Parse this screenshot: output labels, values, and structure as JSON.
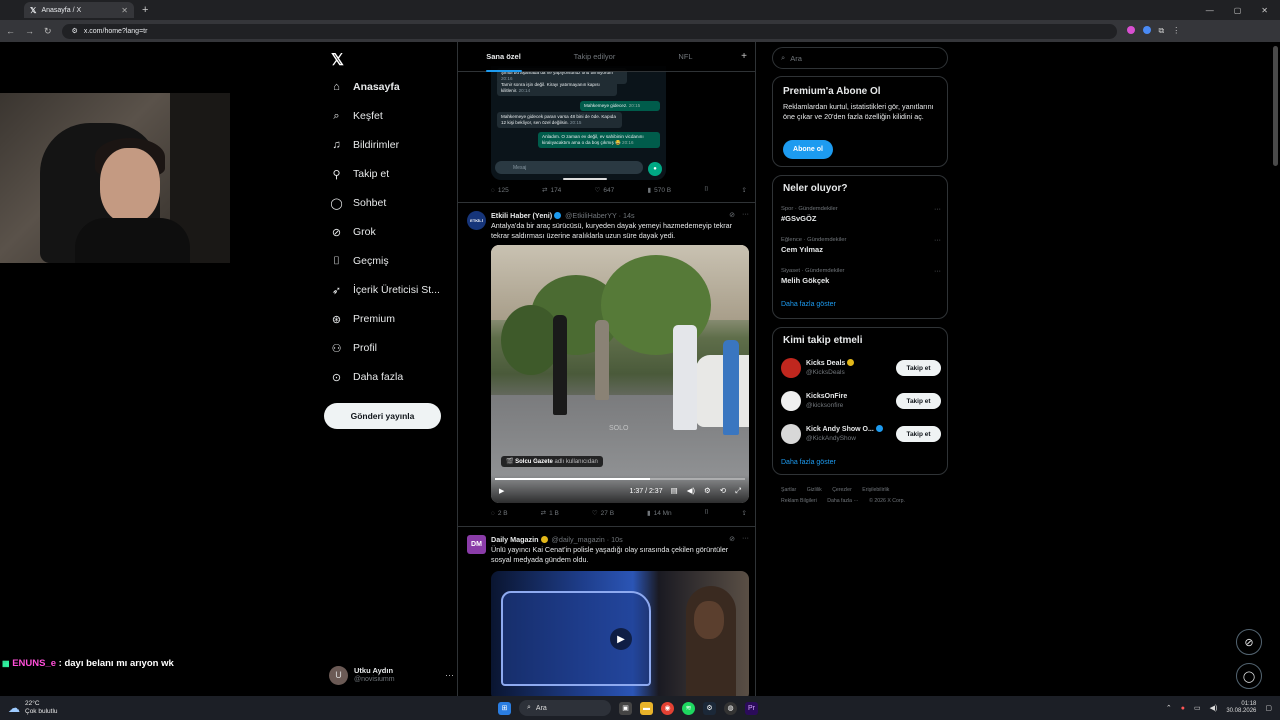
{
  "browser": {
    "tab_title": "Anasayfa / X",
    "url": "x.com/home?lang=tr"
  },
  "stream": {
    "chat_user": "ENUNS_e",
    "chat_message": ": dayı belanı mı arıyon wk"
  },
  "nav": {
    "items": [
      {
        "label": "Anasayfa",
        "icon": "home-icon"
      },
      {
        "label": "Keşfet",
        "icon": "search-icon"
      },
      {
        "label": "Bildirimler",
        "icon": "bell-icon"
      },
      {
        "label": "Takip et",
        "icon": "follow-icon"
      },
      {
        "label": "Sohbet",
        "icon": "chat-icon"
      },
      {
        "label": "Grok",
        "icon": "grok-icon"
      },
      {
        "label": "Geçmiş",
        "icon": "bookmark-icon"
      },
      {
        "label": "İçerik Üreticisi St...",
        "icon": "rocket-icon"
      },
      {
        "label": "Premium",
        "icon": "premium-icon"
      },
      {
        "label": "Profil",
        "icon": "person-icon"
      },
      {
        "label": "Daha fazla",
        "icon": "more-circle-icon"
      }
    ],
    "post_button": "Gönderi yayınla",
    "profile_name": "Utku Aydın",
    "profile_handle": "@novisiumm",
    "profile_initial": "U"
  },
  "feed": {
    "tabs": [
      "Sana özel",
      "Takip edilyor",
      "NFL"
    ],
    "whatsapp": {
      "messages": [
        {
          "text": "Şimdi bu aşamada da ne yapıyorsunuz onu bilmiyorum",
          "time": "20:16",
          "dir": "in"
        },
        {
          "text": "Tamir sonra işin değil. Kirayı yatırmayanın kapısı kilitlenir.",
          "time": "20:14",
          "dir": "in"
        },
        {
          "text": "Mahkemeye gidecez.",
          "time": "20:15",
          "dir": "out"
        },
        {
          "text": "Mahkemeye gidecek paran varsa 48 bini de öde. Kapıda 12 kişi bekliyor, sen özel değilsin.",
          "time": "20:15",
          "dir": "in"
        },
        {
          "text": "Anladım. O zaman ev değil, ev sahibinin vicdanını kiralıyacaktım ama o da boş çıkmış 😂",
          "time": "20:16",
          "dir": "out"
        }
      ],
      "input_placeholder": "Mesaj"
    },
    "post0_actions": {
      "replies": "125",
      "reposts": "174",
      "likes": "647",
      "views": "570 B"
    },
    "posts": [
      {
        "name": "Etkili Haber (Yeni)",
        "handle": "@EtkiliHaberYY",
        "time": "14s",
        "avatar_text": "ETKİLİ",
        "text": "Antalya'da bir araç sürücüsü, kuryeden dayak yemeyi hazmedemeyip tekrar tekrar saldırması üzerine aralıklarla uzun süre dayak yedi.",
        "credit_source": "Solcu Gazete",
        "credit_suffix": "adlı kullanıcıdan",
        "watermark": "SOLO",
        "video_time": "1:37 / 2:37",
        "video_progress": 0.62,
        "actions": {
          "replies": "2 B",
          "reposts": "1 B",
          "likes": "27 B",
          "views": "14 Mn"
        }
      },
      {
        "name": "Daily Magazin",
        "handle": "@daily_magazin",
        "time": "10s",
        "avatar_text": "DM",
        "text": "Ünlü yayıncı Kai Cenat'in polisle yaşadığı olay sırasında çekilen görüntüler sosyal medyada gündem oldu."
      }
    ]
  },
  "sidebar": {
    "search_placeholder": "Ara",
    "premium": {
      "title": "Premium'a Abone Ol",
      "desc": "Reklamlardan kurtul, istatistikleri gör, yanıtlarını öne çıkar ve 20'den fazla özelliğin kilidini aç.",
      "button": "Abone ol"
    },
    "trends": {
      "title": "Neler oluyor?",
      "items": [
        {
          "category": "Spor · Gündemdekiler",
          "topic": "#GSvGÖZ"
        },
        {
          "category": "Eğlence · Gündemdekiler",
          "topic": "Cem Yılmaz"
        },
        {
          "category": "Siyaset · Gündemdekiler",
          "topic": "Melih Gökçek"
        }
      ],
      "show_more": "Daha fazla göster"
    },
    "who_to_follow": {
      "title": "Kimi takip etmeli",
      "items": [
        {
          "name": "Kicks Deals",
          "handle": "@KicksDeals",
          "button": "Takip et",
          "badge": "gold"
        },
        {
          "name": "KicksOnFire",
          "handle": "@kicksonfire",
          "button": "Takip et",
          "badge": "none"
        },
        {
          "name": "Kick Andy Show O...",
          "handle": "@KickAndyShow",
          "button": "Takip et",
          "badge": "blue"
        }
      ],
      "show_more": "Daha fazla göster"
    },
    "footer": [
      "Şartlar",
      "Gizlilik",
      "Çerezler",
      "Erişilebilirlik",
      "Reklam Bilgileri",
      "Daha fazla ···",
      "© 2026 X Corp."
    ]
  },
  "taskbar": {
    "temp": "22°C",
    "weather": "Çok bulutlu",
    "search": "Ara",
    "time": "01:18",
    "date": "30.08.2026"
  },
  "colors": {
    "accent": "#1d9bf0",
    "bg": "#000000",
    "text": "#e7e9ea",
    "muted": "#71767b",
    "border": "#2f3336"
  }
}
